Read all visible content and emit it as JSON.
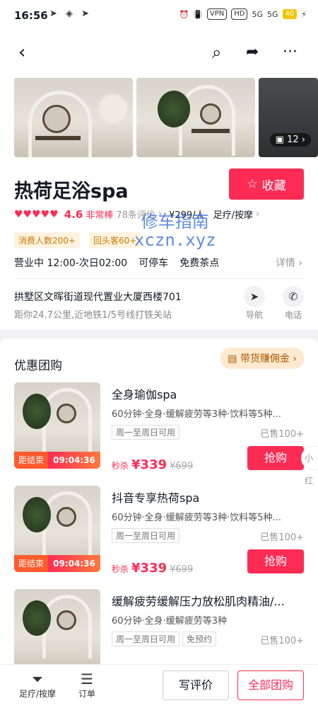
{
  "status_bar": {
    "time": "16:56",
    "vpn": "VPN",
    "hd": "HD",
    "net1": "5G",
    "net2": "5G",
    "battery": "40"
  },
  "gallery": {
    "photo_count": "12"
  },
  "shop": {
    "name": "热荷足浴spa",
    "favorite_label": "收藏",
    "score": "4.6",
    "score_label": "非常棒",
    "reviews": "78条评价",
    "price_per_person": "¥299/人",
    "category": "足疗/按摩",
    "tags": [
      "消费人数200+",
      "回头客60+"
    ],
    "status": "营业中 12:00-次日02:00",
    "parking": "可停车",
    "tea": "免费茶点",
    "detail_label": "详情",
    "address": "拱墅区文晖街道现代置业大厦西楼701",
    "distance": "距你24.7公里,近地铁1/5号线打铁关站",
    "nav_label": "导航",
    "phone_label": "电话"
  },
  "deals_section": {
    "title": "优惠团购",
    "commission_label": "带货赚佣金",
    "items": [
      {
        "name": "全身瑜伽spa",
        "desc": "60分钟·全身·缓解疲劳等3种·饮料等5种...",
        "avail": [
          "周一至周日可用"
        ],
        "sold": "已售100+",
        "price_prefix": "秒杀",
        "price": "¥339",
        "orig": "¥699",
        "timer_label": "距结束",
        "timer": "09:04:36",
        "buy": "抢购"
      },
      {
        "name": "抖音专享热荷spa",
        "desc": "60分钟·全身·缓解疲劳等3种·饮料等5种...",
        "avail": [
          "周一至周日可用"
        ],
        "sold": "已售100+",
        "price_prefix": "秒杀",
        "price": "¥339",
        "orig": "¥699",
        "timer_label": "距结束",
        "timer": "09:04:36",
        "buy": "抢购"
      },
      {
        "name": "缓解疲劳缓解压力放松肌肉精油/...",
        "desc": "60分钟·全身·缓解疲劳等3种",
        "avail": [
          "周一至周日可用",
          "免预约"
        ],
        "sold": "已售100+"
      }
    ],
    "peek_label": "小红"
  },
  "bottom_bar": {
    "tab1": "足疗/按摩",
    "tab2": "订单",
    "review": "写评价",
    "all_deals": "全部团购"
  },
  "watermark": {
    "line1": "修车指南",
    "line2": "xczn.xyz"
  },
  "colors": {
    "accent": "#fe2c55",
    "tag_bg": "#fff3e0"
  }
}
